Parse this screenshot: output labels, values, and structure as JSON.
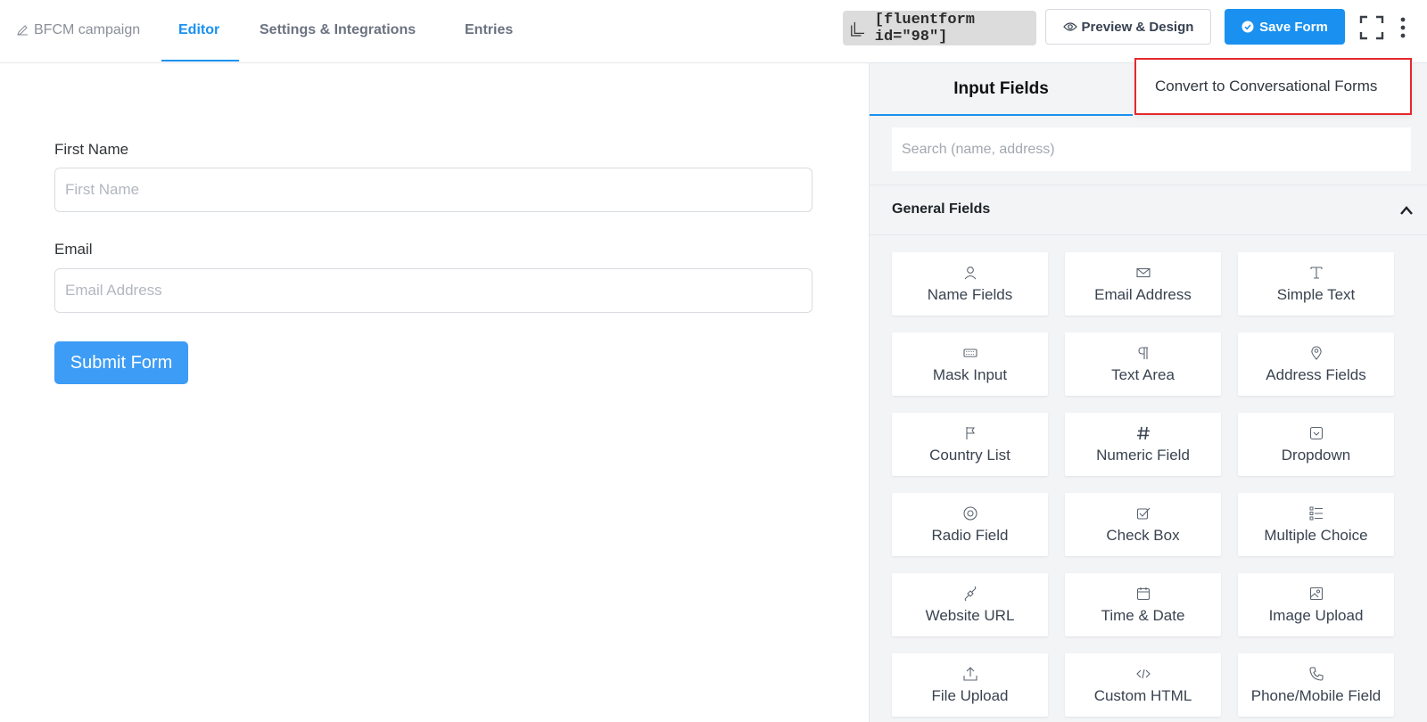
{
  "header": {
    "form_name": "BFCM campaign",
    "tabs": [
      "Editor",
      "Settings & Integrations",
      "Entries"
    ],
    "active_tab": "Editor",
    "shortcode": "[fluentform id=\"98\"]",
    "preview_label": "Preview & Design",
    "save_label": "Save Form",
    "menu_item": "Convert to Conversational Forms"
  },
  "form": {
    "fields": [
      {
        "label": "First Name",
        "placeholder": "First Name"
      },
      {
        "label": "Email",
        "placeholder": "Email Address"
      }
    ],
    "submit_label": "Submit Form"
  },
  "panel": {
    "tab_label": "Input Fields",
    "search_placeholder": "Search (name, address)",
    "section_title": "General Fields",
    "fields": [
      {
        "label": "Name Fields",
        "icon": "person-icon"
      },
      {
        "label": "Email Address",
        "icon": "envelope-icon"
      },
      {
        "label": "Simple Text",
        "icon": "text-cursor-icon"
      },
      {
        "label": "Mask Input",
        "icon": "keyboard-icon"
      },
      {
        "label": "Text Area",
        "icon": "paragraph-icon"
      },
      {
        "label": "Address Fields",
        "icon": "map-pin-icon"
      },
      {
        "label": "Country List",
        "icon": "flag-icon"
      },
      {
        "label": "Numeric Field",
        "icon": "hash-icon"
      },
      {
        "label": "Dropdown",
        "icon": "dropdown-icon"
      },
      {
        "label": "Radio Field",
        "icon": "radio-icon"
      },
      {
        "label": "Check Box",
        "icon": "checkbox-icon"
      },
      {
        "label": "Multiple Choice",
        "icon": "list-icon"
      },
      {
        "label": "Website URL",
        "icon": "link-icon"
      },
      {
        "label": "Time & Date",
        "icon": "calendar-icon"
      },
      {
        "label": "Image Upload",
        "icon": "image-icon"
      },
      {
        "label": "File Upload",
        "icon": "upload-icon"
      },
      {
        "label": "Custom HTML",
        "icon": "code-icon"
      },
      {
        "label": "Phone/Mobile Field",
        "icon": "phone-icon"
      }
    ]
  },
  "colors": {
    "accent": "#1a91f0",
    "submit": "#3d9cf5",
    "highlight_border": "#e5282c",
    "panel_bg": "#f3f4f6"
  }
}
